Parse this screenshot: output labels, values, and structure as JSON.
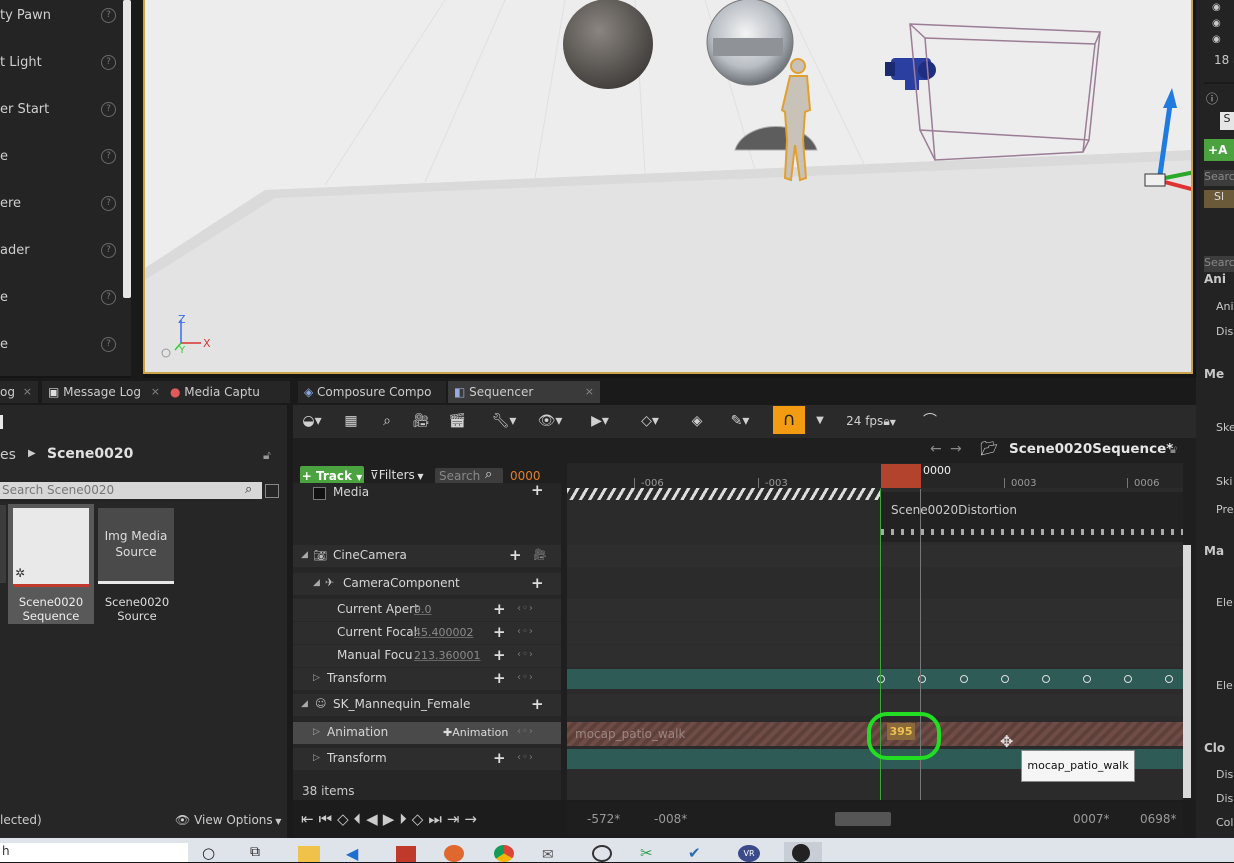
{
  "place_actors": {
    "items": [
      "ty Pawn",
      "t Light",
      "er Start",
      "e",
      "ere",
      "ader",
      "e",
      "e"
    ]
  },
  "viewport": {
    "axis": {
      "z": "Z",
      "x": "X",
      "y": "Y"
    }
  },
  "right_panel": {
    "items": [
      "18 a",
      "S",
      "A",
      "Searc",
      "Sl",
      "Searc",
      "Ani",
      "Ani",
      "Dis",
      "Me",
      "Ske",
      "Ski",
      "Pre",
      "Ma",
      "Ele",
      "Ele",
      "Clo",
      "Dis",
      "Dis",
      "Col"
    ]
  },
  "tabs": [
    {
      "label": "og"
    },
    {
      "label": "Message Log"
    },
    {
      "label": "Media Captu"
    },
    {
      "label": "Composure Compo"
    },
    {
      "label": "Sequencer"
    }
  ],
  "content_browser": {
    "breadcrumb": {
      "prev": "es",
      "current": "Scene0020"
    },
    "search_placeholder": "Search Scene0020",
    "assets": [
      {
        "label": "Scene0020 Sequence"
      },
      {
        "label": "Scene0020 Source",
        "thumb_text": "Img Media Source"
      }
    ],
    "item_count": "38 items",
    "selection_text": "lected)",
    "view_options": "View Options"
  },
  "sequencer": {
    "fps": "24 fps",
    "sequence_name": "Scene0020Sequence*",
    "track_button": "Track",
    "filters_button": "Filters",
    "search_placeholder": "Search",
    "current_frame": "0000",
    "playhead_frame": "0000",
    "ruler_ticks": [
      "-006",
      "-003",
      "0003",
      "0006"
    ],
    "tracks": {
      "media": "Media",
      "cine_camera": "CineCamera",
      "camera_component": "CameraComponent",
      "current_aperture": {
        "label": "Current Apert",
        "value": "9.0"
      },
      "current_focal": {
        "label": "Current Focal",
        "value": "45.400002"
      },
      "manual_focus": {
        "label": "Manual Focu",
        "value": "213.360001"
      },
      "transform1": "Transform",
      "mannequin": "SK_Mannequin_Female",
      "animation": {
        "label": "Animation",
        "add": "Animation"
      },
      "transform2": "Transform"
    },
    "sections": {
      "media_section": "Scene0020Distortion",
      "anim_section": "mocap_patio_walk",
      "anim_frame_badge": "395",
      "tooltip": "mocap_patio_walk"
    },
    "range": {
      "view_start": "-572*",
      "work_start": "-008*",
      "work_end": "0007*",
      "view_end": "0698*"
    }
  },
  "colors": {
    "accent_orange": "#f39c12",
    "track_green": "#4aa33e",
    "highlight_green": "#22dd22",
    "playhead_red": "#b4432e",
    "transform_teal": "#2f5b57"
  }
}
